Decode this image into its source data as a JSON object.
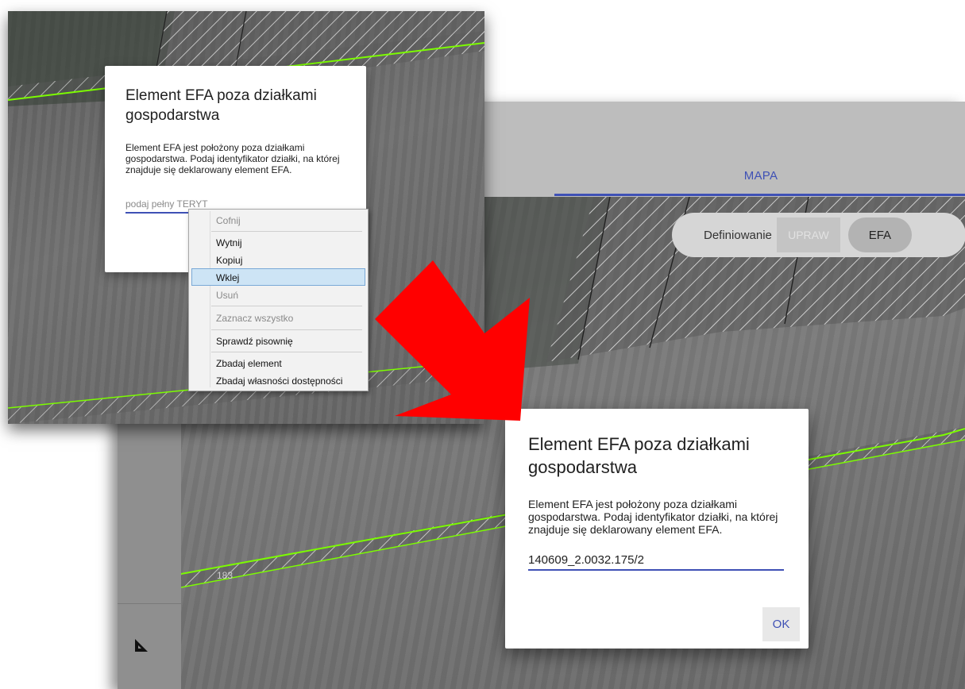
{
  "back_app": {
    "tab": "MAPA",
    "mode_toggle": {
      "label": "Definiowanie",
      "options": [
        "UPRAW",
        "EFA"
      ]
    },
    "parcel_number": "183",
    "toolbar": [
      "copy-shape-icon",
      "pencil-icon",
      "select-rect-icon",
      "measure-angle-icon"
    ]
  },
  "dialog_filled": {
    "title": "Element EFA poza działkami gospodarstwa",
    "body": "Element EFA jest położony poza działkami gospodarstwa. Podaj identyfikator działki, na której znajduje się deklarowany element EFA.",
    "input_value": "140609_2.0032.175/2",
    "ok_label": "OK"
  },
  "dialog_empty": {
    "title": "Element EFA poza działkami gospodarstwa",
    "body": "Element EFA jest położony poza działkami gospodarstwa. Podaj identyfikator działki, na której znajduje się deklarowany element EFA.",
    "input_placeholder": "podaj pełny TERYT działki"
  },
  "context_menu": {
    "items": [
      {
        "label": "Cofnij",
        "disabled": true
      },
      {
        "label": "Wytnij",
        "disabled": false
      },
      {
        "label": "Kopiuj",
        "disabled": false
      },
      {
        "label": "Wklej",
        "disabled": false,
        "highlighted": true
      },
      {
        "label": "Usuń",
        "disabled": true
      },
      {
        "label": "Zaznacz wszystko",
        "disabled": true
      },
      {
        "label": "Sprawdź pisownię",
        "disabled": false
      },
      {
        "label": "Zbadaj element",
        "disabled": false
      },
      {
        "label": "Zbadaj własności dostępności",
        "disabled": false
      }
    ]
  },
  "colors": {
    "accent": "#3f51b5",
    "arrow": "#ff0000",
    "parcel_border": "#7CFC00",
    "menu_highlight": "#cde4f5"
  }
}
